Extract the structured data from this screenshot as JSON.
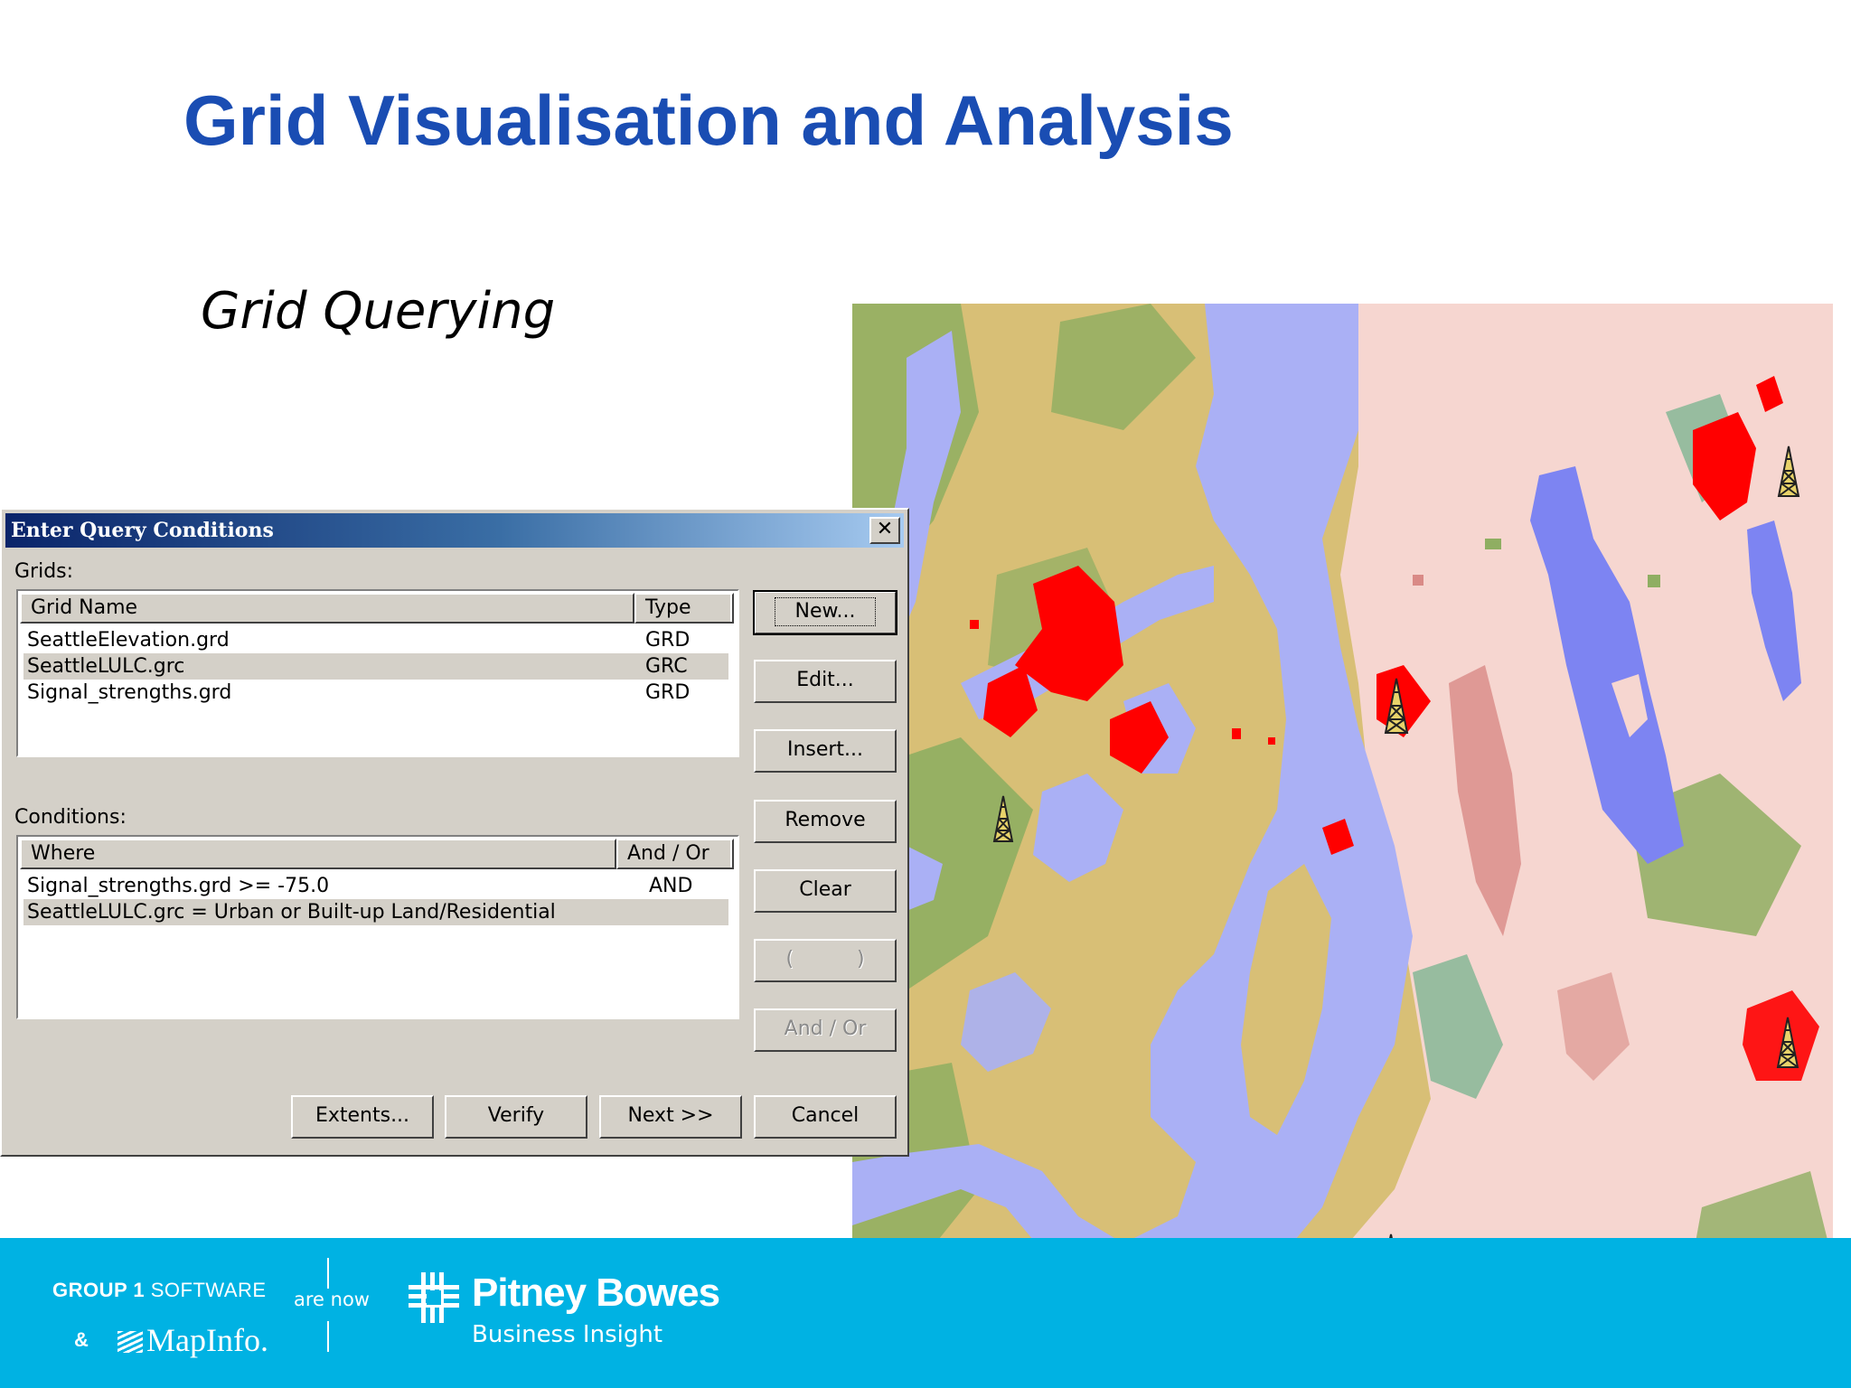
{
  "slide": {
    "title": "Grid Visualisation and Analysis",
    "subtitle": "Grid Querying"
  },
  "dialog": {
    "title": "Enter Query Conditions",
    "close_glyph": "✕",
    "grids_label": "Grids:",
    "grids_columns": [
      "Grid Name",
      "Type"
    ],
    "grids_rows": [
      {
        "name": "SeattleElevation.grd",
        "type": "GRD",
        "selected": false
      },
      {
        "name": "SeattleLULC.grc",
        "type": "GRC",
        "selected": true
      },
      {
        "name": "Signal_strengths.grd",
        "type": "GRD",
        "selected": false
      }
    ],
    "conditions_label": "Conditions:",
    "conditions_columns": [
      "Where",
      "And / Or"
    ],
    "conditions_rows": [
      {
        "where": "Signal_strengths.grd >= -75.0",
        "andor": "AND",
        "selected": false
      },
      {
        "where": "SeattleLULC.grc = Urban or Built-up Land/Residential",
        "andor": "",
        "selected": true
      }
    ],
    "side_buttons": {
      "new": "New...",
      "edit": "Edit...",
      "insert": "Insert...",
      "remove": "Remove",
      "clear": "Clear",
      "parens": "(          )",
      "andor": "And / Or"
    },
    "bottom_buttons": {
      "extents": "Extents...",
      "verify": "Verify",
      "next": "Next >>",
      "cancel": "Cancel"
    }
  },
  "footer": {
    "group1_bold": "GROUP 1",
    "group1_thin": " SOFTWARE",
    "amp": "&",
    "mapinfo": "MapInfo.",
    "are_now": "are now",
    "brand": "Pitney Bowes",
    "brand_sub": "Business Insight",
    "band_color": "#00b2e3"
  },
  "map": {
    "tower_icon": "transmission-tower-icon",
    "colors": {
      "water": "#aab0f5",
      "lake": "#7d84f2",
      "land_tan": "#d8bf76",
      "forest": "#8fae62",
      "urban_pink": "#f6d6d0",
      "urban_dark": "#d98a86",
      "query_result": "#ff0000",
      "wetland": "#6fb08a"
    }
  }
}
